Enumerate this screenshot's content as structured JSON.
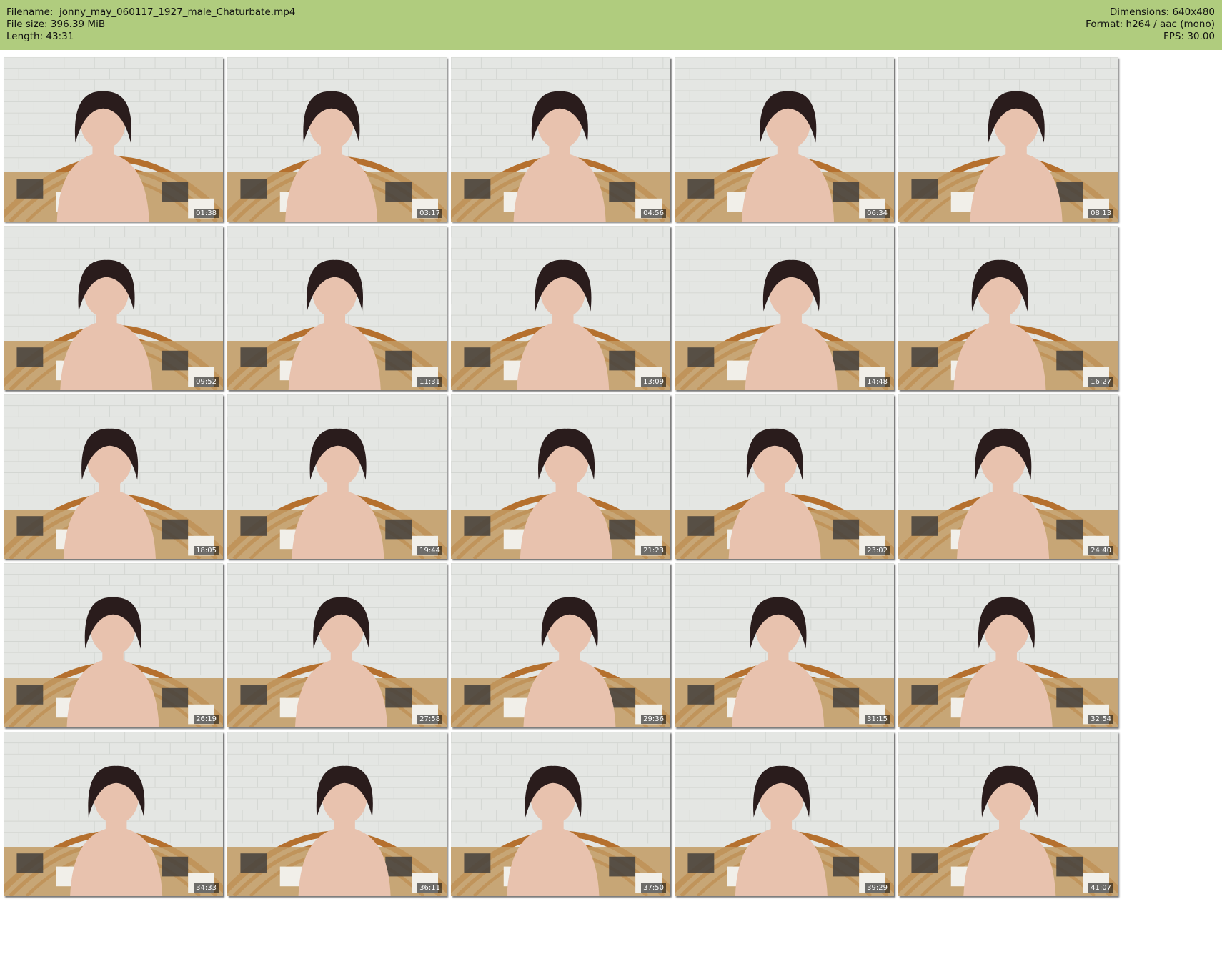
{
  "header": {
    "filename_label": "Filename:",
    "filename": "jonny_may_060117_1927_male_Chaturbate.mp4",
    "filesize_label": "File size:",
    "filesize": "396.39 MiB",
    "length_label": "Length:",
    "length": "43:31",
    "dimensions_label": "Dimensions:",
    "dimensions": "640x480",
    "format_label": "Format:",
    "format": "h264 / aac (mono)",
    "fps_label": "FPS:",
    "fps": "30.00"
  },
  "colors": {
    "header_bg": "#b0cc7e",
    "wall": "#e4e6e3",
    "rattan": "#b5702e",
    "skin": "#e8c2ae",
    "hair": "#2a1c1c",
    "blanket_dark": "#3b3a3a",
    "blanket_tan": "#c29a63"
  },
  "thumbnails": [
    {
      "time": "01:38"
    },
    {
      "time": "03:17"
    },
    {
      "time": "04:56"
    },
    {
      "time": "06:34"
    },
    {
      "time": "08:13"
    },
    {
      "time": "09:52"
    },
    {
      "time": "11:31"
    },
    {
      "time": "13:09"
    },
    {
      "time": "14:48"
    },
    {
      "time": "16:27"
    },
    {
      "time": "18:05"
    },
    {
      "time": "19:44"
    },
    {
      "time": "21:23"
    },
    {
      "time": "23:02"
    },
    {
      "time": "24:40"
    },
    {
      "time": "26:19"
    },
    {
      "time": "27:58"
    },
    {
      "time": "29:36"
    },
    {
      "time": "31:15"
    },
    {
      "time": "32:54"
    },
    {
      "time": "34:33"
    },
    {
      "time": "36:11"
    },
    {
      "time": "37:50"
    },
    {
      "time": "39:29"
    },
    {
      "time": "41:07"
    }
  ]
}
